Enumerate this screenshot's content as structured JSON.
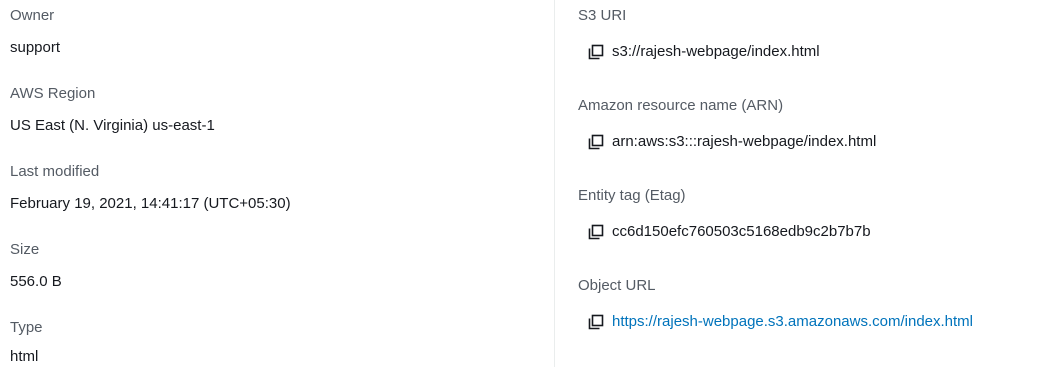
{
  "left": {
    "owner": {
      "label": "Owner",
      "value": "support"
    },
    "region": {
      "label": "AWS Region",
      "value": "US East (N. Virginia) us-east-1"
    },
    "last_modified": {
      "label": "Last modified",
      "value": "February 19, 2021, 14:41:17 (UTC+05:30)"
    },
    "size": {
      "label": "Size",
      "value": "556.0 B"
    },
    "type": {
      "label": "Type",
      "value": "html"
    }
  },
  "right": {
    "s3_uri": {
      "label": "S3 URI",
      "value": "s3://rajesh-webpage/index.html",
      "icon": "copy-icon"
    },
    "arn": {
      "label": "Amazon resource name (ARN)",
      "value": "arn:aws:s3:::rajesh-webpage/index.html",
      "icon": "copy-icon"
    },
    "etag": {
      "label": "Entity tag (Etag)",
      "value": "cc6d150efc760503c5168edb9c2b7b7b",
      "icon": "copy-icon"
    },
    "object_url": {
      "label": "Object URL",
      "value": "https://rajesh-webpage.s3.amazonaws.com/index.html",
      "icon": "copy-icon"
    }
  },
  "colors": {
    "label": "#545b64",
    "value": "#16191f",
    "link": "#0073bb",
    "divider": "#eaeded"
  }
}
